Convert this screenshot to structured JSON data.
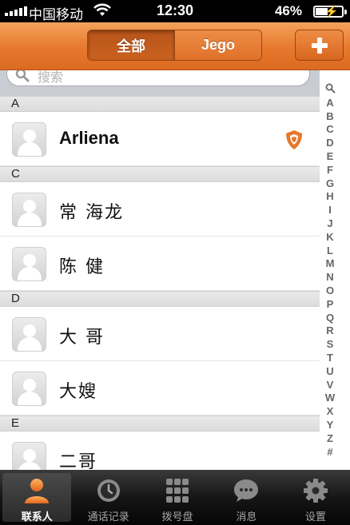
{
  "status_bar": {
    "carrier": "中国移动",
    "time": "12:30",
    "battery": "46%",
    "battery_level": 0.46
  },
  "nav": {
    "segments": [
      "全部",
      "Jego"
    ],
    "selected_segment": "全部",
    "add_icon": "plus-icon"
  },
  "search": {
    "placeholder": "搜索"
  },
  "contacts": {
    "sections": [
      {
        "letter": "A",
        "items": [
          {
            "name": "Arliena",
            "jego_badge": true
          }
        ]
      },
      {
        "letter": "C",
        "items": [
          {
            "name": "常 海龙"
          },
          {
            "name": "陈 健"
          }
        ]
      },
      {
        "letter": "D",
        "items": [
          {
            "name": "大 哥"
          },
          {
            "name": "大嫂"
          }
        ]
      },
      {
        "letter": "E",
        "items": [
          {
            "name": "二哥"
          }
        ]
      }
    ]
  },
  "index_bar": [
    "search-icon",
    "A",
    "B",
    "C",
    "D",
    "E",
    "F",
    "G",
    "H",
    "I",
    "J",
    "K",
    "L",
    "M",
    "N",
    "O",
    "P",
    "Q",
    "R",
    "S",
    "T",
    "U",
    "V",
    "W",
    "X",
    "Y",
    "Z",
    "#"
  ],
  "tab_bar": {
    "tabs": [
      {
        "label": "联系人",
        "icon": "person-icon",
        "active": true
      },
      {
        "label": "通话记录",
        "icon": "clock-icon",
        "active": false
      },
      {
        "label": "拨号盘",
        "icon": "keypad-icon",
        "active": false
      },
      {
        "label": "消息",
        "icon": "chat-bubble-icon",
        "active": false
      },
      {
        "label": "设置",
        "icon": "gear-icon",
        "active": false
      }
    ]
  },
  "colors": {
    "accent": "#e6782d",
    "accent_dark": "#b8541a",
    "tab_bar": "#161616"
  }
}
